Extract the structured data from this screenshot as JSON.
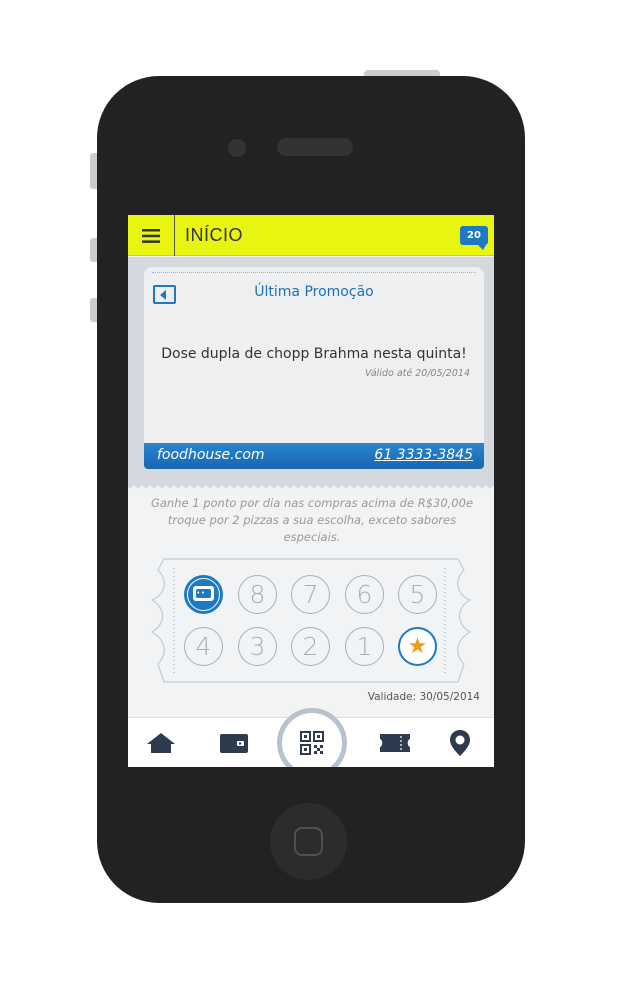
{
  "header": {
    "title": "INÍCIO",
    "notification_count": "20"
  },
  "promo": {
    "title": "Última Promoção",
    "text": "Dose dupla de chopp Brahma nesta quinta!",
    "valid_until": "Válido até 20/05/2014",
    "website": "foodhouse.com",
    "phone": "61 3333-3845"
  },
  "loyalty": {
    "description": "Ganhe 1 ponto por dia nas compras acima de R$30,00e troque por 2 pizzas a sua escolha, exceto sabores especiais.",
    "stamps_row1": [
      "8",
      "7",
      "6",
      "5"
    ],
    "stamps_row2": [
      "4",
      "3",
      "2",
      "1"
    ],
    "validity": "Validade: 30/05/2014"
  },
  "tabs": [
    {
      "icon": "home-icon"
    },
    {
      "icon": "wallet-icon"
    },
    {
      "icon": "qr-code-icon"
    },
    {
      "icon": "ticket-icon"
    },
    {
      "icon": "location-pin-icon"
    }
  ],
  "colors": {
    "accent_yellow": "#e8f511",
    "primary_blue": "#1f78c4",
    "star_orange": "#f49a13",
    "phone_body": "#222222"
  }
}
